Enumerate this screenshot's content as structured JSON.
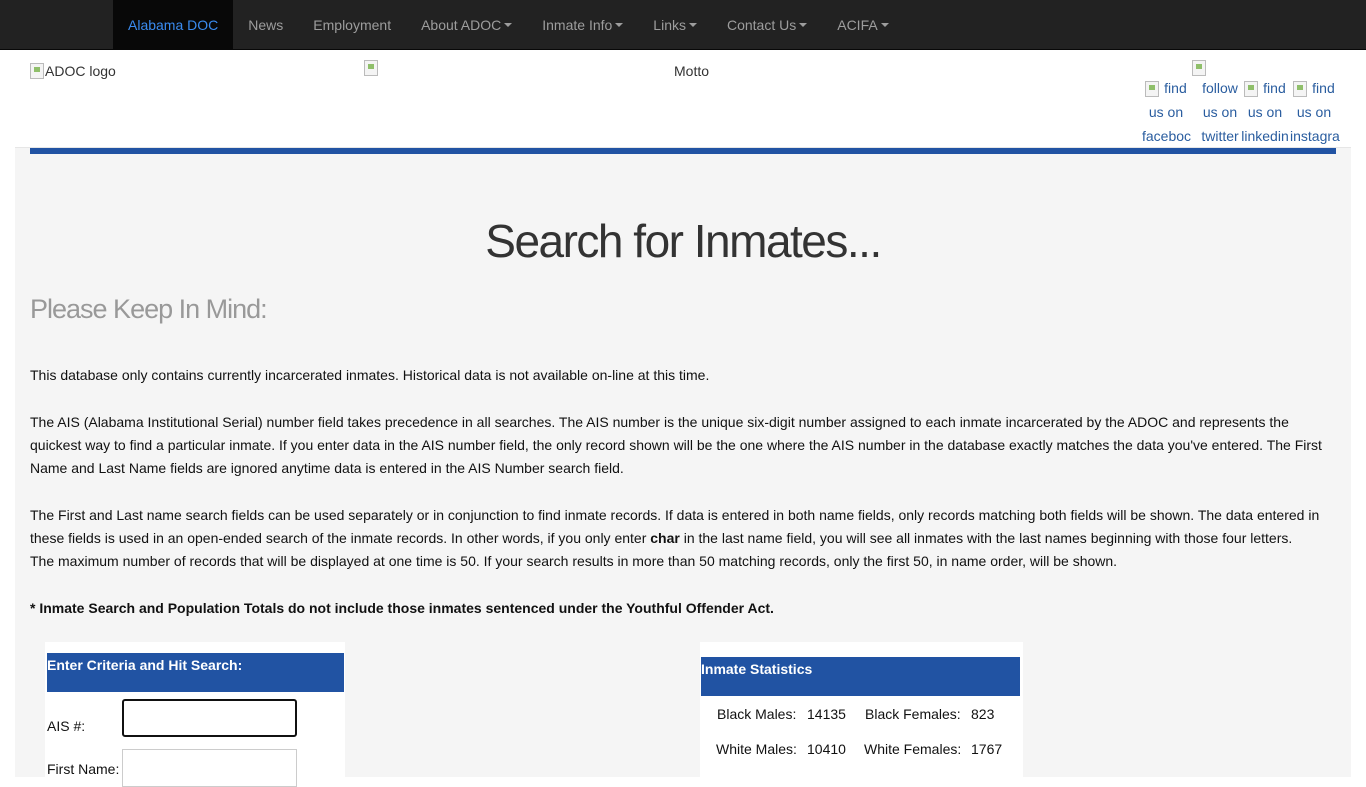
{
  "nav": {
    "items": [
      {
        "label": "Alabama DOC",
        "active": true,
        "dropdown": false
      },
      {
        "label": "News",
        "active": false,
        "dropdown": false
      },
      {
        "label": "Employment",
        "active": false,
        "dropdown": false
      },
      {
        "label": "About ADOC",
        "active": false,
        "dropdown": true
      },
      {
        "label": "Inmate Info",
        "active": false,
        "dropdown": true
      },
      {
        "label": "Links",
        "active": false,
        "dropdown": true
      },
      {
        "label": "Contact Us",
        "active": false,
        "dropdown": true
      },
      {
        "label": "ACIFA",
        "active": false,
        "dropdown": true
      }
    ]
  },
  "header": {
    "logo_alt": "ADOC logo",
    "motto": "Motto",
    "social": [
      {
        "label": "find us on faceboc"
      },
      {
        "label": "follow us on twitter"
      },
      {
        "label": "find us on linkedin"
      },
      {
        "label": "find us on instagra"
      }
    ]
  },
  "main": {
    "title": "Search for Inmates...",
    "subtitle": "Please Keep In Mind:",
    "para1": "This database only contains currently incarcerated inmates. Historical data is not available on-line at this time.",
    "para2": "The AIS (Alabama Institutional Serial) number field takes precedence in all searches. The AIS number is the unique six-digit number assigned to each inmate incarcerated by the ADOC and represents the quickest way to find a particular inmate. If you enter data in the AIS number field, the only record shown will be the one where the AIS number in the database exactly matches the data you've entered. The First Name and Last Name fields are ignored anytime data is entered in the AIS Number search field.",
    "para3_before": "The First and Last name search fields can be used separately or in conjunction to find inmate records. If data is entered in both name fields, only records matching both fields will be shown. The data entered in these fields is used in an open-ended search of the inmate records. In other words, if you only enter ",
    "para3_bold": "char",
    "para3_after": " in the last name field, you will see all inmates with the last names beginning with those four letters.",
    "para4": "The maximum number of records that will be displayed at one time is 50. If your search results in more than 50 matching records, only the first 50, in name order, will be shown.",
    "note": "* Inmate Search and Population Totals do not include those inmates sentenced under the Youthful Offender Act."
  },
  "search": {
    "heading": "Enter Criteria and Hit Search:",
    "ais_label": "AIS #:",
    "ais_value": "",
    "first_name_label": "First Name:",
    "first_name_value": ""
  },
  "stats": {
    "heading": "Inmate Statistics",
    "black_males_label": "Black Males:",
    "black_males_value": "14135",
    "black_females_label": "Black Females:",
    "black_females_value": "823",
    "white_males_label": "White Males:",
    "white_males_value": "10410",
    "white_females_label": "White Females:",
    "white_females_value": "1767"
  },
  "colors": {
    "navbar_bg": "#222222",
    "nav_active_text": "#3a8bef",
    "accent_blue": "#2153a3",
    "link_blue": "#2a5d9f"
  }
}
